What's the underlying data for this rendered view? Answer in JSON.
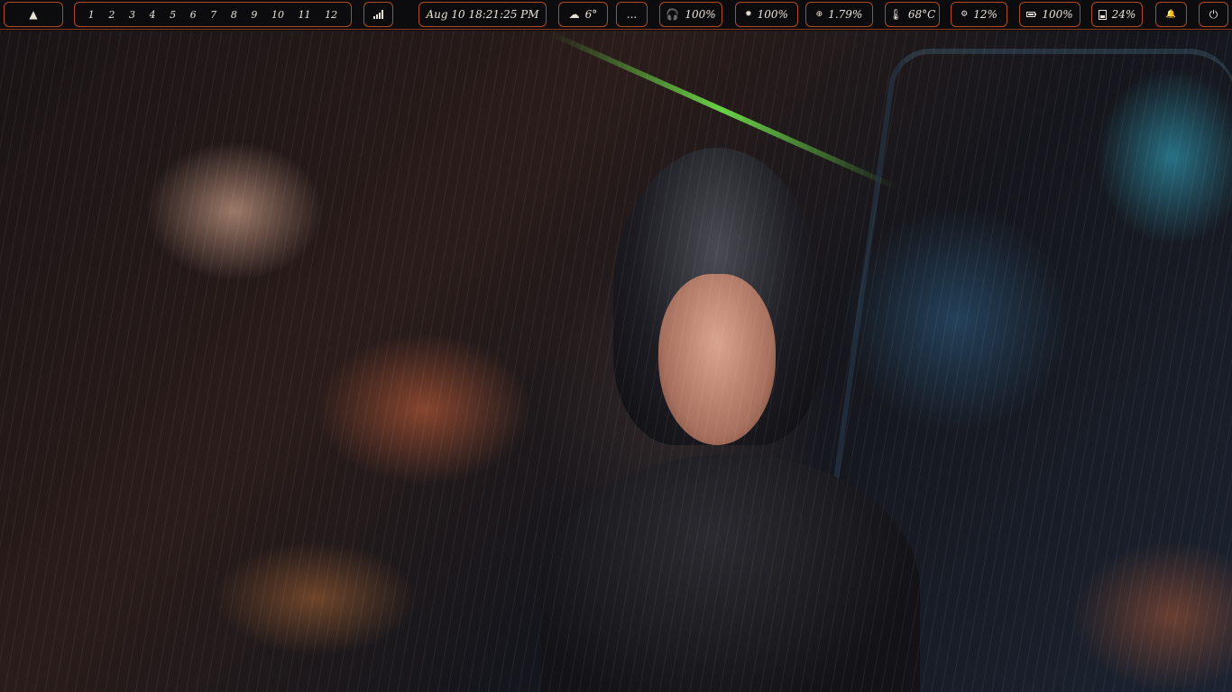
{
  "bar": {
    "launcher_icon": "arch-logo-icon",
    "workspaces": [
      "1",
      "2",
      "3",
      "4",
      "5",
      "6",
      "7",
      "8",
      "9",
      "10",
      "11",
      "12"
    ],
    "network_icon": "signal-bars-icon",
    "clock": "Aug 10 18:21:25 PM",
    "weather": {
      "icon": "rain-cloud-icon",
      "temp": "6°"
    },
    "more_label": "...",
    "headphones": {
      "icon": "headphones-icon",
      "value": "100%"
    },
    "brightness": {
      "icon": "sun-icon",
      "value": "100%"
    },
    "cpu": {
      "icon": "cpu-icon",
      "value": "1.79%"
    },
    "temperature": {
      "icon": "thermometer-icon",
      "value": "68°C"
    },
    "cpu_load": {
      "icon": "gear-icon",
      "value": "12%"
    },
    "battery": {
      "icon": "battery-icon",
      "value": "100%"
    },
    "disk": {
      "icon": "disk-icon",
      "value": "24%"
    },
    "notifications_icon": "bell-icon",
    "power_icon": "power-icon"
  },
  "colors": {
    "bar_bg": "#0c0c0f",
    "accent_border": "#b04a20",
    "text": "#e9e2d8"
  }
}
